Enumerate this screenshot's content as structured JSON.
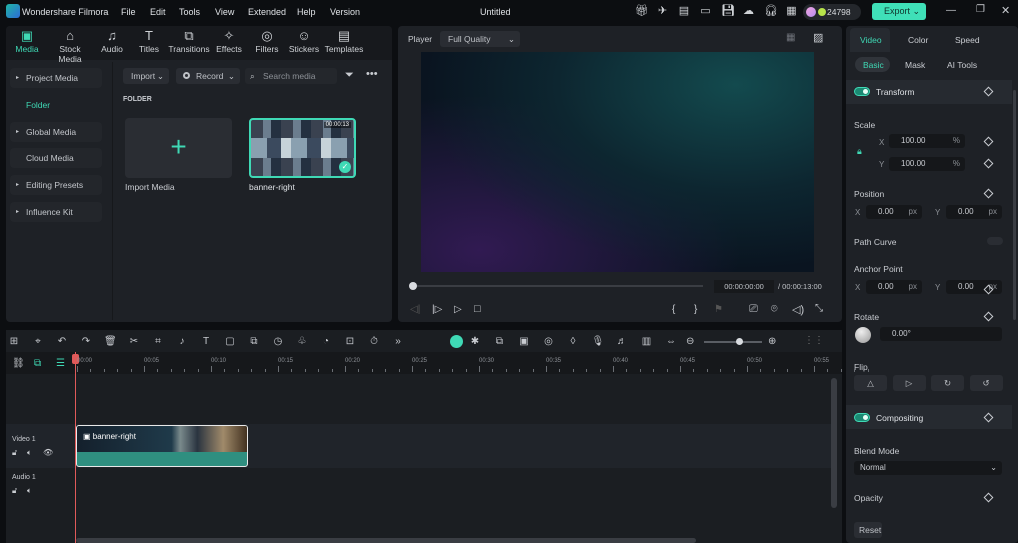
{
  "app": {
    "name": "Wondershare Filmora",
    "document_title": "Untitled",
    "credits": "24798",
    "export_label": "Export",
    "accent": "#3fd9b5"
  },
  "menu": [
    "File",
    "Edit",
    "Tools",
    "View",
    "Extended",
    "Help",
    "Version"
  ],
  "top_icons": [
    "gift-icon",
    "send-icon",
    "notes-icon",
    "monitor-icon",
    "save-icon",
    "cloud-upload-icon",
    "headset-icon",
    "apps-icon"
  ],
  "media_tabs": [
    {
      "label": "Media",
      "icon": "▣"
    },
    {
      "label": "Stock Media",
      "icon": "⌂"
    },
    {
      "label": "Audio",
      "icon": "♫"
    },
    {
      "label": "Titles",
      "icon": "T"
    },
    {
      "label": "Transitions",
      "icon": "⧉"
    },
    {
      "label": "Effects",
      "icon": "✧"
    },
    {
      "label": "Filters",
      "icon": "◎"
    },
    {
      "label": "Stickers",
      "icon": "☺"
    },
    {
      "label": "Templates",
      "icon": "▤"
    }
  ],
  "sidebar": [
    {
      "label": "Project Media",
      "bullet": true
    },
    {
      "label": "Folder",
      "active": true
    },
    {
      "label": "Global Media",
      "bullet": true
    },
    {
      "label": "Cloud Media"
    },
    {
      "label": "Editing Presets",
      "bullet": true
    },
    {
      "label": "Influence Kit",
      "bullet": true
    }
  ],
  "media_toolbar": {
    "import": "Import",
    "record": "Record",
    "search_placeholder": "Search media"
  },
  "folder_label": "FOLDER",
  "media_items": [
    {
      "label": "Import Media"
    },
    {
      "label": "banner-right",
      "duration": "00:00:13"
    }
  ],
  "player": {
    "label": "Player",
    "quality": "Full Quality",
    "current_time": "00:00:00:00",
    "total_time": "/ 00:00:13:00",
    "progress": 0
  },
  "right_panel": {
    "tabs": [
      "Video",
      "Color",
      "Speed"
    ],
    "subtabs": [
      "Basic",
      "Mask",
      "AI Tools"
    ],
    "transform": "Transform",
    "scale": "Scale",
    "scale_x": "100.00",
    "scale_y": "100.00",
    "percent": "%",
    "position": "Position",
    "pos_x": "0.00",
    "pos_y": "0.00",
    "px": "px",
    "path_curve": "Path Curve",
    "anchor": "Anchor Point",
    "anchor_x": "0.00",
    "anchor_y": "0.00",
    "rotate": "Rotate",
    "rotate_val": "0.00°",
    "flip": "Flip",
    "compositing": "Compositing",
    "blend_mode": "Blend Mode",
    "blend_value": "Normal",
    "opacity": "Opacity",
    "reset": "Reset",
    "x": "X",
    "y": "Y"
  },
  "timeline": {
    "ticks": [
      "00:00",
      "00:05",
      "00:10",
      "00:15",
      "00:20",
      "00:25",
      "00:30",
      "00:35",
      "00:40",
      "00:45",
      "00:50",
      "00:55"
    ],
    "tracks": [
      {
        "label": "Video 1"
      },
      {
        "label": "Audio 1"
      }
    ],
    "clip": "banner-right",
    "zoom_level": 0.6
  }
}
